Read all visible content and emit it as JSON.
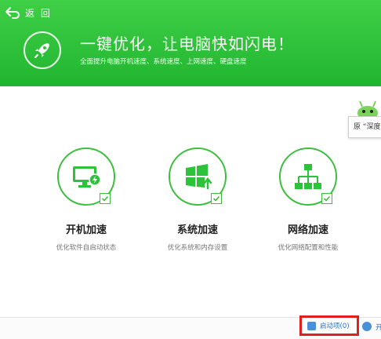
{
  "header": {
    "back_label": "返 回",
    "headline": "一键优化，让电脑快如闪电！",
    "subline": "全面提升电脑开机速度、系统速度、上网速度、硬盘速度",
    "accent": "#2cc23a"
  },
  "tooltip": {
    "text": "原 “深度"
  },
  "cards": [
    {
      "icon": "monitor-lightning-icon",
      "title": "开机加速",
      "desc": "优化软件自启动状态",
      "checked": true
    },
    {
      "icon": "windows-logo-icon",
      "title": "系统加速",
      "desc": "优化系统和内存设置",
      "checked": true
    },
    {
      "icon": "network-hierarchy-icon",
      "title": "网络加速",
      "desc": "优化网络配置和性能",
      "checked": true
    }
  ],
  "footer": {
    "startup_label": "启动项(0)",
    "second_label": "开"
  }
}
